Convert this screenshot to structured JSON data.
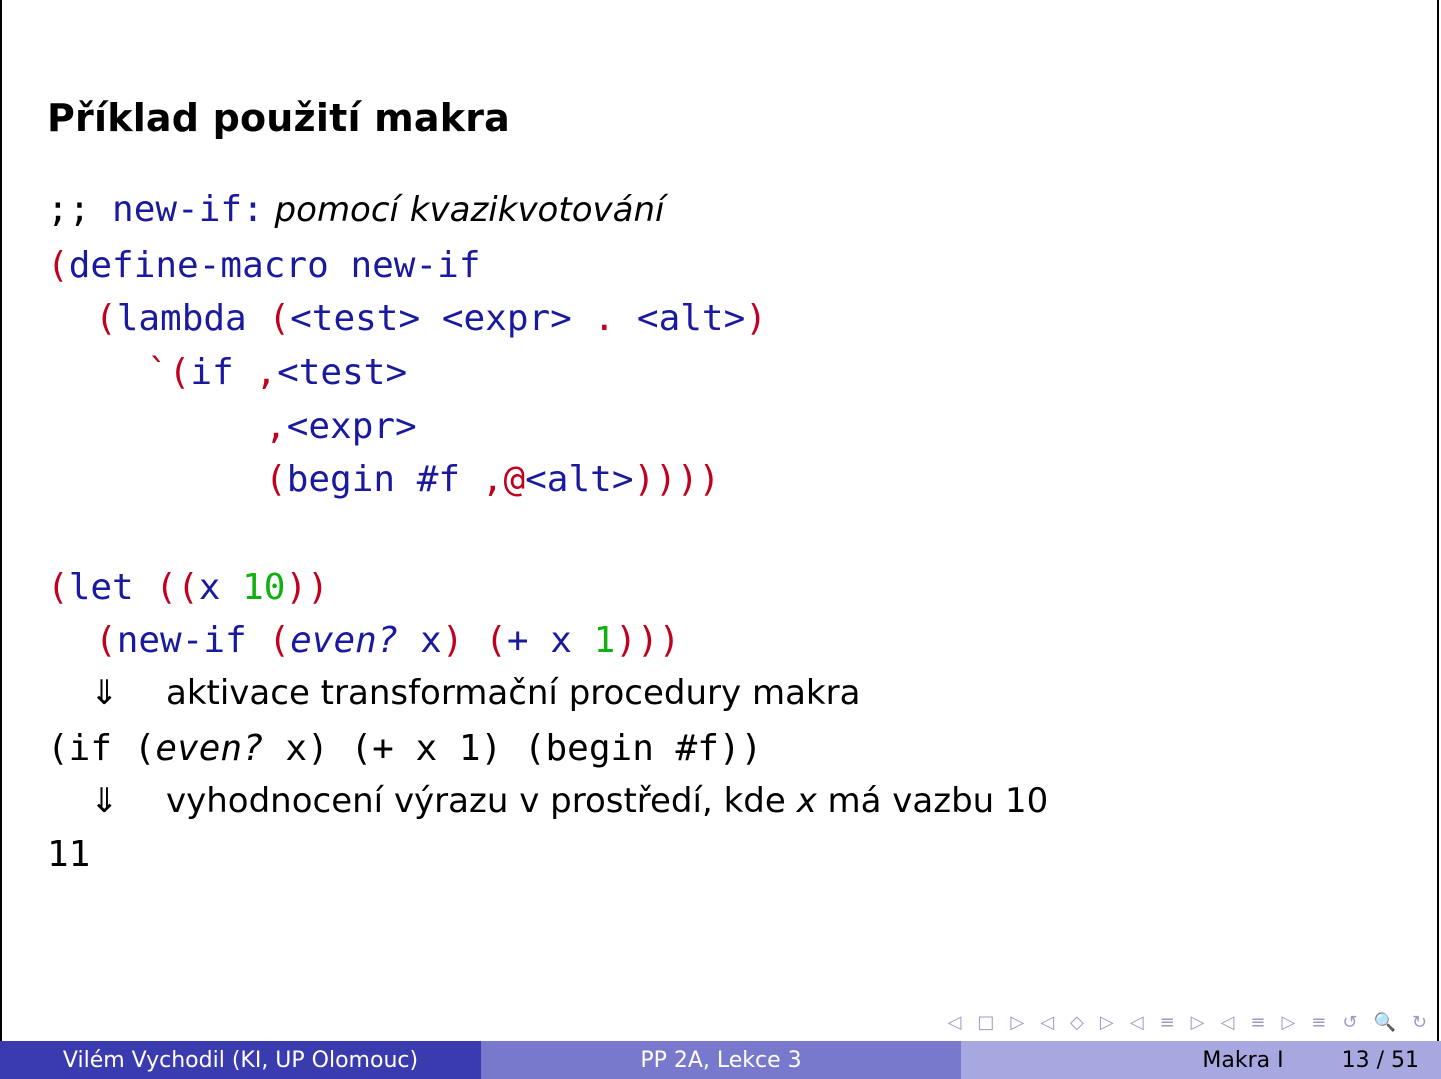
{
  "slide": {
    "title": "Příklad použití makra",
    "comment_prefix": ";; new-if:",
    "comment_text": " pomocí kvazikvotování",
    "code_define": {
      "l1_paren": "(",
      "l1_kw": "define-macro",
      "l1_name": " new-if",
      "l2_paren": "(",
      "l2_kw": "lambda",
      "l2_args_open": " (",
      "l2_test": "<test>",
      "l2_expr": " <expr>",
      "l2_dot": " .",
      "l2_alt": " <alt>",
      "l2_close": ")",
      "l3_quote": "`(",
      "l3_if": "if",
      "l3_comma": " ,",
      "l3_test": "<test>",
      "l4_comma": ",",
      "l4_expr": "<expr>",
      "l5_paren": "(",
      "l5_begin": "begin",
      "l5_f": " #f",
      "l5_splice": " ,@",
      "l5_alt": "<alt>",
      "l5_close": "))))"
    },
    "code_let": {
      "l1_paren": "(",
      "l1_kw": "let",
      "l1_open": " ((",
      "l1_x": "x",
      "l1_num": " 10",
      "l1_close": "))",
      "l2_paren": "(",
      "l2_kw": "new-if",
      "l2_open": " (",
      "l2_even": "even?",
      "l2_x": " x",
      "l2_mid": ") (",
      "l2_plus": "+",
      "l2_x2": " x",
      "l2_one": " 1",
      "l2_close": ")))"
    },
    "step1_arrow": "⇓",
    "step1_text": "aktivace transformační procedury makra",
    "expansion_a": "(if (",
    "expansion_even": "even?",
    "expansion_b": " x) (+ x 1) (begin #f))",
    "step2_arrow": "⇓",
    "step2_text_a": "vyhodnocení výrazu v prostředí, kde ",
    "step2_var": "x",
    "step2_text_b": " má vazbu 10",
    "result": "11"
  },
  "nav_icons": [
    "◁",
    "□",
    "▷",
    "◁",
    "◇",
    "▷",
    "◁",
    "≡",
    "▷",
    "◁",
    "≡",
    "▷",
    "≡",
    "↺",
    "🔍",
    "↻"
  ],
  "footer": {
    "author": "Vilém Vychodil  (KI, UP Olomouc)",
    "course": "PP 2A, Lekce 3",
    "section": "Makra I",
    "page": "13 / 51"
  },
  "colors": {
    "keyword": "#c0001c",
    "identifier": "#1a1a9e",
    "number": "#10b010",
    "footer_dark": "#3b3bb0",
    "footer_mid": "#7878cc",
    "footer_light": "#a8a8e0"
  }
}
